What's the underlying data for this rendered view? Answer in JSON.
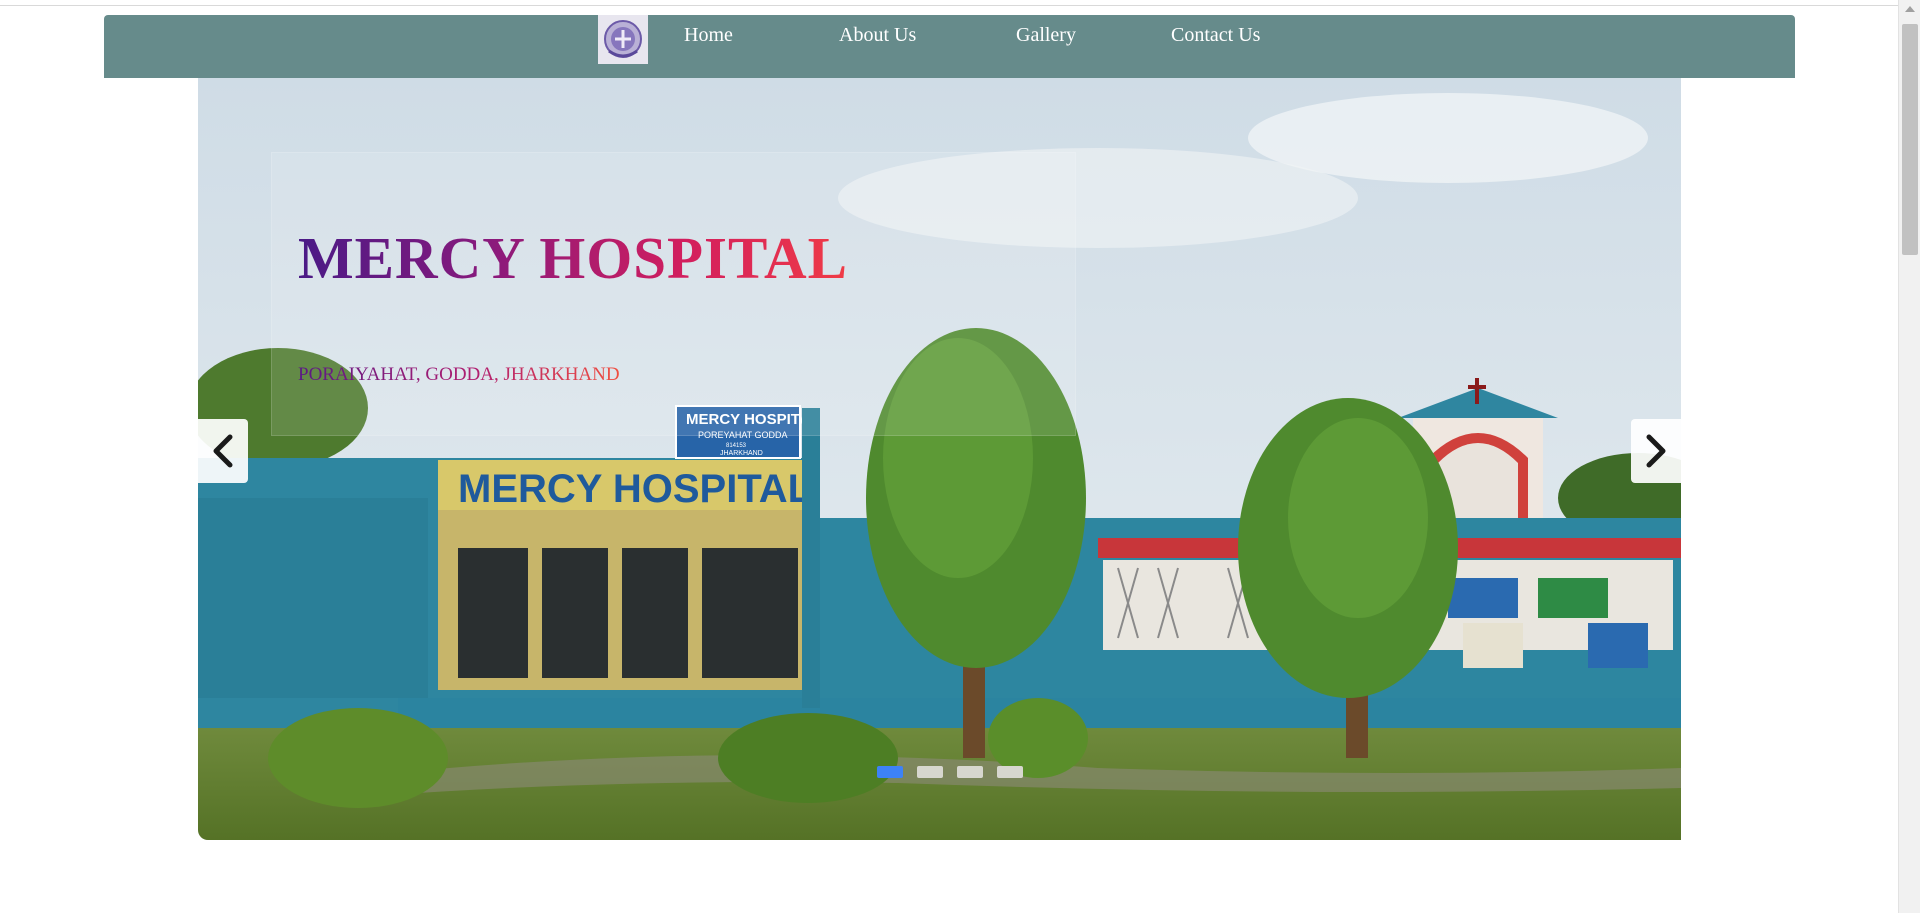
{
  "nav": {
    "logo_icon": "hospital-crest-logo",
    "links": [
      {
        "label": "Home"
      },
      {
        "label": "About Us"
      },
      {
        "label": "Gallery"
      },
      {
        "label": "Contact Us"
      }
    ],
    "background_color": "#668b8b"
  },
  "hero": {
    "title": "MERCY HOSPITAL",
    "subtitle": "PORAIYAHAT, GODDA, JHARKHAND",
    "sign_main": "MERCY HOSPITAL",
    "sign_small_title": "MERCY HOSPITAL",
    "sign_small_line1": "POREYAHAT GODDA",
    "sign_small_line2": "814153",
    "sign_small_line3": "JHARKHAND",
    "prev_icon": "chevron-left-icon",
    "next_icon": "chevron-right-icon"
  },
  "carousel": {
    "slide_count": 4,
    "active_index": 0,
    "active_color": "#3d82f7"
  }
}
